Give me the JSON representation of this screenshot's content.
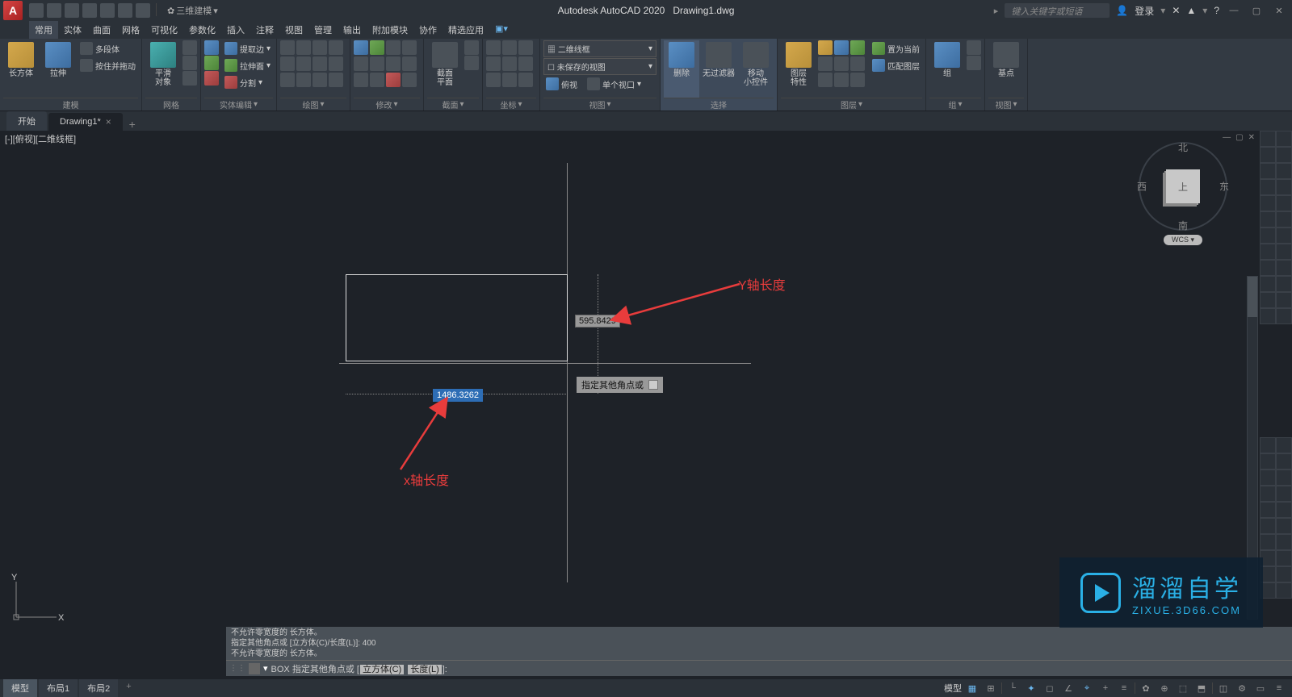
{
  "app": {
    "title": "Autodesk AutoCAD 2020",
    "file": "Drawing1.dwg",
    "search_placeholder": "键入关键字或短语",
    "login": "登录",
    "workspace": "三维建模"
  },
  "menubar": [
    "常用",
    "实体",
    "曲面",
    "网格",
    "可视化",
    "参数化",
    "插入",
    "注释",
    "视图",
    "管理",
    "输出",
    "附加模块",
    "协作",
    "精选应用"
  ],
  "ribbon": {
    "panels": [
      {
        "name": "建模",
        "big": [
          {
            "label": "长方体",
            "cls": "c-yellow"
          },
          {
            "label": "拉伸",
            "cls": "c-blue"
          }
        ],
        "rows": [
          {
            "icon": "c-gray",
            "label": "多段体"
          },
          {
            "icon": "c-gray",
            "label": "按住并拖动"
          }
        ]
      },
      {
        "name": "网格",
        "big": [
          {
            "label": "平滑\n对象",
            "cls": "c-cyan"
          }
        ]
      },
      {
        "name": "实体编辑",
        "big": [],
        "rows": [
          {
            "icon": "c-blue",
            "label": "提取边"
          },
          {
            "icon": "c-green",
            "label": "拉伸面"
          },
          {
            "icon": "c-red",
            "label": "分割"
          }
        ],
        "extraIcons": 6
      },
      {
        "name": "绘图",
        "iconsGrid": 12
      },
      {
        "name": "修改",
        "iconsGrid": 12
      },
      {
        "name": "截面",
        "big": [
          {
            "label": "截面\n平面",
            "cls": "c-gray"
          }
        ]
      },
      {
        "name": "坐标",
        "iconsGrid": 9
      },
      {
        "name": "视图",
        "dropdowns": [
          "二维线框",
          "未保存的视图"
        ],
        "rows2": [
          {
            "icon": "c-blue",
            "label": "俯视"
          },
          {
            "icon": "c-gray",
            "label": "单个视口"
          }
        ]
      },
      {
        "name": "选择",
        "big": [
          {
            "label": "删除",
            "cls": "c-blue",
            "active": true
          },
          {
            "label": "无过滤器",
            "cls": "c-gray"
          },
          {
            "label": "移动\n小控件",
            "cls": "c-gray"
          }
        ]
      },
      {
        "name": "图层",
        "big": [
          {
            "label": "图层\n特性",
            "cls": "c-yellow"
          }
        ],
        "iconsGrid": 9,
        "rows": [
          {
            "icon": "c-gray",
            "label": "置为当前"
          },
          {
            "icon": "c-gray",
            "label": "匹配图层"
          }
        ]
      },
      {
        "name": "组",
        "big": [
          {
            "label": "组",
            "cls": "c-blue"
          }
        ],
        "iconsGrid": 2
      },
      {
        "name": "视图",
        "big": [
          {
            "label": "基点",
            "cls": "c-gray"
          }
        ]
      }
    ]
  },
  "filetabs": {
    "start": "开始",
    "current": "Drawing1*"
  },
  "viewport": {
    "label": "[-][俯视][二维线框]"
  },
  "viewcube": {
    "n": "北",
    "s": "南",
    "e": "东",
    "w": "西",
    "top": "上",
    "wcs": "WCS"
  },
  "drawing": {
    "dim_y": "595.8429",
    "dim_x": "1486.3262",
    "tooltip": "指定其他角点或",
    "anno_y": "Y轴长度",
    "anno_x": "x轴长度"
  },
  "cmd": {
    "hist1": "不允许零宽度的 长方体。",
    "hist2": "指定其他角点或 [立方体(C)/长度(L)]: 400",
    "hist3": "不允许零宽度的 长方体。",
    "prompt_cmd": "BOX",
    "prompt_text": "指定其他角点或",
    "opt1": "立方体(C)",
    "opt2": "长度(L)"
  },
  "status": {
    "tabs": [
      "模型",
      "布局1",
      "布局2"
    ],
    "model": "模型"
  },
  "watermark": {
    "main": "溜溜自学",
    "sub": "ZIXUE.3D66.COM"
  },
  "ucs": {
    "x": "X",
    "y": "Y"
  }
}
